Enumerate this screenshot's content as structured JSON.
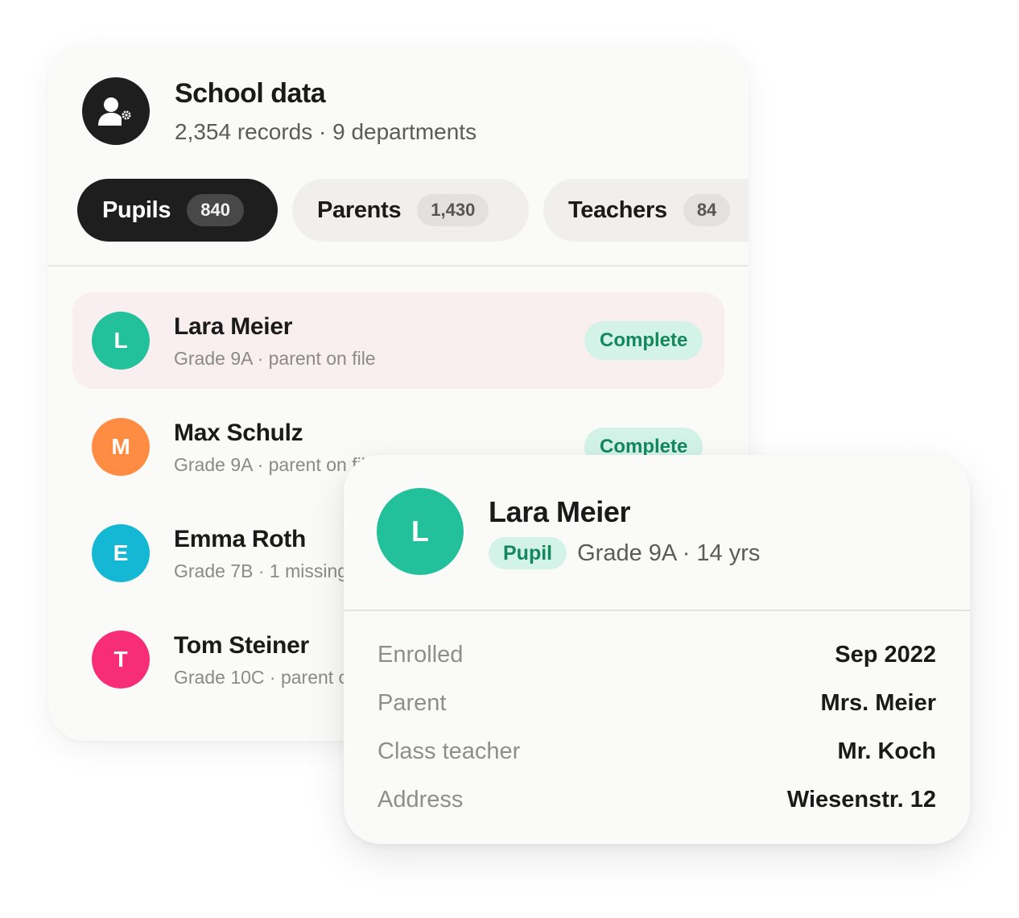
{
  "header": {
    "icon": "user-settings-icon",
    "title": "School data",
    "subtitle": "2,354 records · 9 departments"
  },
  "tabs": [
    {
      "label": "Pupils",
      "count": "840",
      "active": true
    },
    {
      "label": "Parents",
      "count": "1,430",
      "active": false
    },
    {
      "label": "Teachers",
      "count": "84",
      "active": false
    }
  ],
  "rows": [
    {
      "initial": "L",
      "name": "Lara Meier",
      "subtitle": "Grade 9A · parent on file",
      "status": "Complete",
      "avatar_color": "#23c09c",
      "selected": true
    },
    {
      "initial": "M",
      "name": "Max Schulz",
      "subtitle": "Grade 9A · parent on file",
      "status": "Complete",
      "avatar_color": "#ff8c42"
    },
    {
      "initial": "E",
      "name": "Emma Roth",
      "subtitle": "Grade 7B · 1 missing",
      "avatar_color": "#14b8d4"
    },
    {
      "initial": "T",
      "name": "Tom Steiner",
      "subtitle": "Grade 10C · parent on file",
      "avatar_color": "#f72d78"
    }
  ],
  "detail": {
    "initial": "L",
    "name": "Lara Meier",
    "role": "Pupil",
    "info": "Grade 9A · 14 yrs",
    "fields": [
      {
        "label": "Enrolled",
        "value": "Sep 2022"
      },
      {
        "label": "Parent",
        "value": "Mrs. Meier"
      },
      {
        "label": "Class teacher",
        "value": "Mr. Koch"
      },
      {
        "label": "Address",
        "value": "Wiesenstr. 12"
      }
    ]
  },
  "colors": {
    "dark": "#1e1e1e",
    "status_bg": "#d4f3e8",
    "status_text": "#14875f",
    "selected_row": "#f9eef0"
  }
}
